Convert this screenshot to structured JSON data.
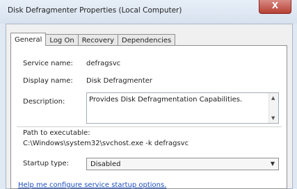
{
  "window": {
    "title": "Disk Defragmenter Properties (Local Computer)",
    "close_glyph": "X"
  },
  "tabs": [
    {
      "label": "General"
    },
    {
      "label": "Log On"
    },
    {
      "label": "Recovery"
    },
    {
      "label": "Dependencies"
    }
  ],
  "general": {
    "service_name_label": "Service name:",
    "service_name_value": "defragsvc",
    "display_name_label": "Display name:",
    "display_name_value": "Disk Defragmenter",
    "description_label": "Description:",
    "description_value": "Provides Disk Defragmentation Capabilities.",
    "path_label": "Path to executable:",
    "path_value": "C:\\Windows\\system32\\svchost.exe -k defragsvc",
    "startup_type_label": "Startup type:",
    "startup_type_value": "Disabled",
    "help_link": "Help me configure service startup options."
  }
}
